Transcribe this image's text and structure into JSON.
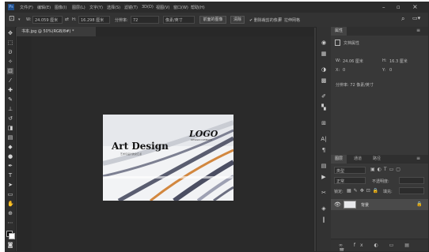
{
  "menu": [
    "文件(F)",
    "编辑(E)",
    "图像(I)",
    "图层(L)",
    "文字(Y)",
    "选择(S)",
    "滤镜(T)",
    "3D(D)",
    "视图(V)",
    "窗口(W)",
    "帮助(H)"
  ],
  "options": {
    "width_label": "W:",
    "width_value": "24.059 厘米",
    "height_label": "H:",
    "height_value": "16.298 厘米",
    "resolution_label": "分辨率:",
    "resolution_value": "72",
    "resolution_unit": "像素/英寸",
    "front_image_button": "前面的图像",
    "clear_button": "清除",
    "delete_crop_label": "✔ 删除裁剪的像素",
    "checked_label": "☑",
    "show_grid_label": "拉伸网格"
  },
  "document": {
    "tab_label": "书本.jpg @ 50%(RGB/8#) *",
    "art_title": "Art Design",
    "art_subtitle": "艺术与设计的交汇点",
    "logo_text": "LOGO",
    "logo_sub": "DESIGN COMPANY"
  },
  "panel": {
    "properties_tab": "属性",
    "doc_props_label": "文档属性",
    "w_label": "W:",
    "w_value": "24.06 厘米",
    "h_label": "H:",
    "h_value": "16.3 厘米",
    "x_label": "X:",
    "x_value": "0",
    "y_label": "Y:",
    "y_value": "0",
    "resolution_text": "分辨率: 72 像素/英寸",
    "layers_tab": "图层",
    "channels_tab": "通道",
    "paths_tab": "路径",
    "kind_filter": "类型",
    "blend_mode": "正常",
    "opacity_label": "不透明度:",
    "lock_label": "锁定:",
    "fill_label": "填充:",
    "layer_name": "背景"
  },
  "colors": {
    "app_bg": "#3b3b3b",
    "document_bg": "#282828",
    "panel_bg": "#383838",
    "accent_orange": "#d2873f"
  }
}
